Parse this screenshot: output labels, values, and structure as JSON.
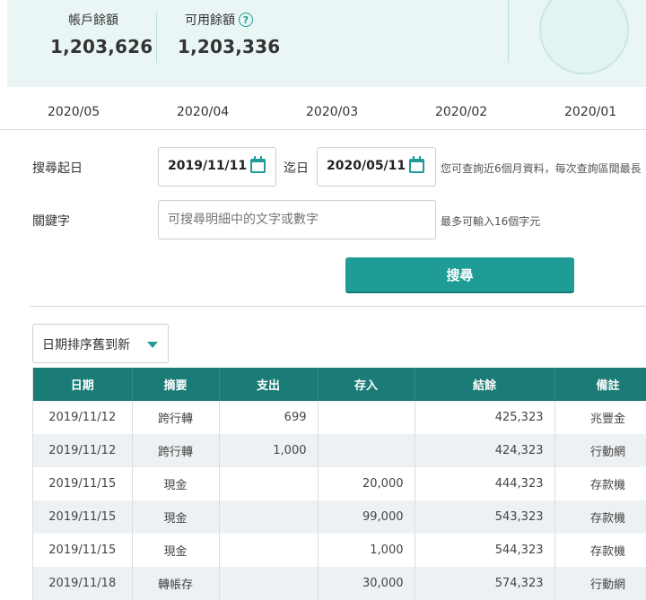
{
  "balance": {
    "account_label": "帳戶餘額",
    "account_value": "1,203,626",
    "available_label": "可用餘額",
    "available_value": "1,203,336",
    "help_glyph": "?"
  },
  "months": [
    "2020/05",
    "2020/04",
    "2020/03",
    "2020/02",
    "2020/01"
  ],
  "search": {
    "start_label": "搜尋起日",
    "start_date": "2019/11/11",
    "to_label": "迄日",
    "end_date": "2020/05/11",
    "date_hint": "您可查詢近6個月資料，每次查詢區間最長",
    "keyword_label": "關鍵字",
    "keyword_placeholder": "可搜尋明細中的文字或數字",
    "keyword_value": "",
    "keyword_hint": "最多可輸入16個字元",
    "button_label": "搜尋"
  },
  "sort": {
    "selected": "日期排序舊到新"
  },
  "table": {
    "headers": [
      "日期",
      "摘要",
      "支出",
      "存入",
      "結餘",
      "備註"
    ],
    "rows": [
      [
        "2019/11/12",
        "跨行轉",
        "699",
        "",
        "425,323",
        "兆豐金"
      ],
      [
        "2019/11/12",
        "跨行轉",
        "1,000",
        "",
        "424,323",
        "行動網"
      ],
      [
        "2019/11/15",
        "現金",
        "",
        "20,000",
        "444,323",
        "存款機"
      ],
      [
        "2019/11/15",
        "現金",
        "",
        "99,000",
        "543,323",
        "存款機"
      ],
      [
        "2019/11/15",
        "現金",
        "",
        "1,000",
        "544,323",
        "存款機"
      ],
      [
        "2019/11/18",
        "轉帳存",
        "",
        "30,000",
        "574,323",
        "行動網"
      ]
    ]
  },
  "colors": {
    "accent": "#1f9c95",
    "header_bg": "#1b7b76",
    "panel_bg": "#eaf6f5"
  }
}
